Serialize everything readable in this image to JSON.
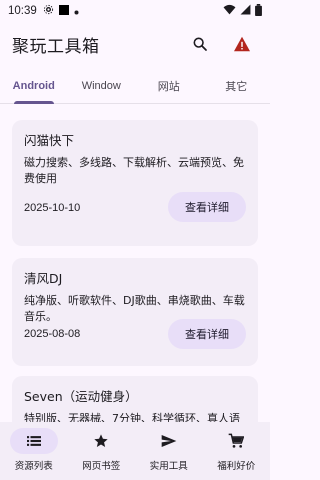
{
  "status_bar": {
    "time": "10:39"
  },
  "app_bar": {
    "title": "聚玩工具箱",
    "actions": [
      "search-icon",
      "warning-icon"
    ]
  },
  "tabs": [
    {
      "label": "Android",
      "active": true
    },
    {
      "label": "Window",
      "active": false
    },
    {
      "label": "网站",
      "active": false
    },
    {
      "label": "其它",
      "active": false
    }
  ],
  "cards": [
    {
      "title": "闪猫快下",
      "description": "磁力搜索、多线路、下载解析、云端预览、免费使用",
      "date": "2025-10-10",
      "button": "查看详细"
    },
    {
      "title": "清风DJ",
      "description": "纯净版、听歌软件、DJ歌曲、串烧歌曲、车载音乐。",
      "date": "2025-08-08",
      "button": "查看详细"
    },
    {
      "title": "Seven（运动健身）",
      "description": "特别版、无器械、7分钟、科学循环、真人语",
      "date": "",
      "button": ""
    }
  ],
  "bottom_nav": [
    {
      "label": "资源列表",
      "icon": "list-icon",
      "active": true
    },
    {
      "label": "网页书签",
      "icon": "star-icon",
      "active": false
    },
    {
      "label": "实用工具",
      "icon": "send-icon",
      "active": false
    },
    {
      "label": "福利好价",
      "icon": "cart-icon",
      "active": false
    }
  ],
  "colors": {
    "primary": "#65558f",
    "surface": "#fdf7ff",
    "card": "#f3edf7",
    "tonal": "#e8def8",
    "warning": "#b3261e"
  }
}
